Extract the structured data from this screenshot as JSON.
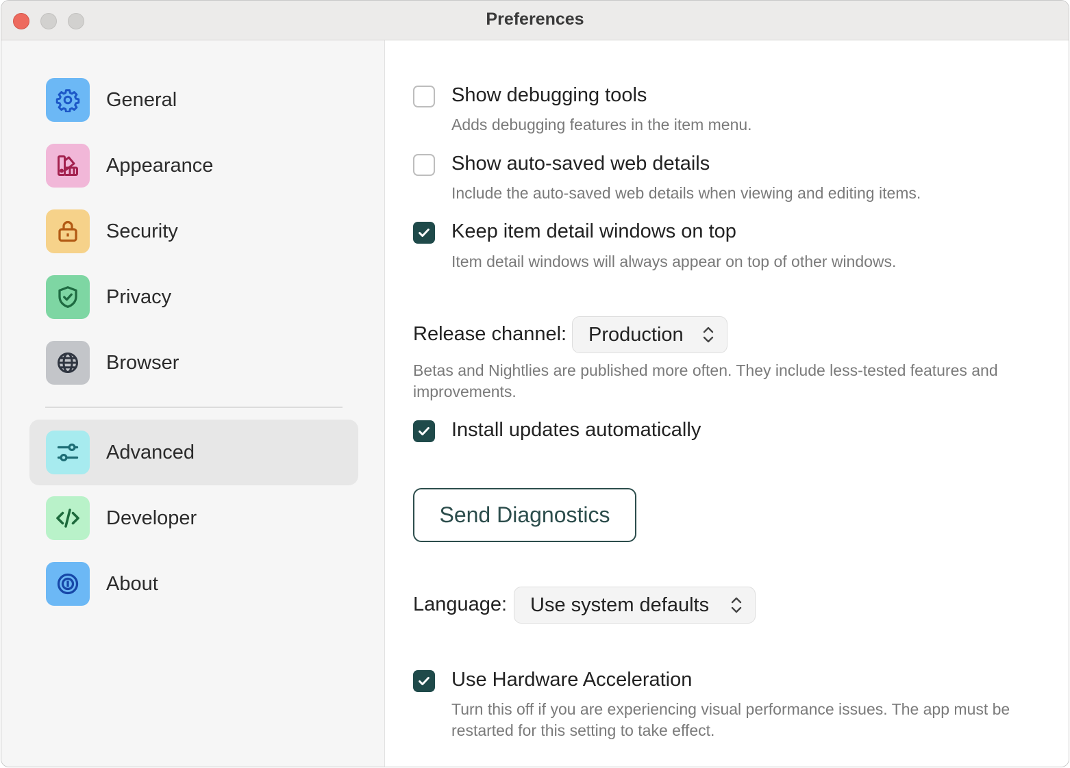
{
  "window": {
    "title": "Preferences"
  },
  "sidebar": {
    "items": [
      {
        "label": "General",
        "icon": "gear-icon",
        "color": "#6cb8f5",
        "selected": false
      },
      {
        "label": "Appearance",
        "icon": "palette-icon",
        "color": "#f1b7d8",
        "selected": false
      },
      {
        "label": "Security",
        "icon": "lock-icon",
        "color": "#f6d28a",
        "selected": false
      },
      {
        "label": "Privacy",
        "icon": "shield-check-icon",
        "color": "#7ed6a3",
        "selected": false
      },
      {
        "label": "Browser",
        "icon": "globe-icon",
        "color": "#c3c5c9",
        "selected": false
      },
      {
        "label": "Advanced",
        "icon": "sliders-icon",
        "color": "#a7ebef",
        "selected": true
      },
      {
        "label": "Developer",
        "icon": "code-icon",
        "color": "#b9f2c9",
        "selected": false
      },
      {
        "label": "About",
        "icon": "target-icon",
        "color": "#6cb8f5",
        "selected": false
      }
    ]
  },
  "options": {
    "debugging": {
      "title": "Show debugging tools",
      "description": "Adds debugging features in the item menu.",
      "checked": false
    },
    "autosaved": {
      "title": "Show auto-saved web details",
      "description": "Include the auto-saved web details when viewing and editing items.",
      "checked": false
    },
    "on_top": {
      "title": "Keep item detail windows on top",
      "description": "Item detail windows will always appear on top of other windows.",
      "checked": true
    },
    "release_channel": {
      "label": "Release channel:",
      "value": "Production",
      "description": "Betas and Nightlies are published more often. They include less-tested features and improvements."
    },
    "auto_update": {
      "title": "Install updates automatically",
      "checked": true
    },
    "diagnostics": {
      "button_label": "Send Diagnostics"
    },
    "language": {
      "label": "Language:",
      "value": "Use system defaults"
    },
    "hardware_accel": {
      "title": "Use Hardware Acceleration",
      "description": "Turn this off if you are experiencing visual performance issues. The app must be restarted for this setting to take effect.",
      "checked": true
    }
  },
  "colors": {
    "accent": "#1f4a4a",
    "button_text": "#2c4d4c",
    "close_button": "#ed6a5e"
  }
}
